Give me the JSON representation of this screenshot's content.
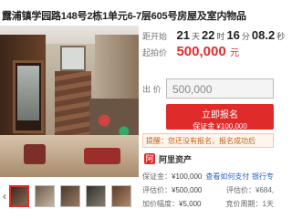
{
  "title": "露浦镇学园路148号2栋1单元6-7层605号房屋及室内物品",
  "countdown": {
    "label": "距开始",
    "days": "21",
    "days_unit": "天",
    "hours": "22",
    "hours_unit": "时",
    "minutes": "16",
    "minutes_unit": "分",
    "seconds": "08.2",
    "seconds_unit": "秒"
  },
  "start_price": {
    "label": "起拍价",
    "value": "500,000",
    "unit": "元"
  },
  "bid": {
    "label": "出 价",
    "value": "500,000"
  },
  "register_button": {
    "line1": "立即报名",
    "line2": "保证金 ¥100,000"
  },
  "notice": "提醒：您还没有报名，报名成功后",
  "brand": {
    "logo_text": "阿",
    "name": "阿里资产"
  },
  "info": {
    "deposit_label": "保证金：",
    "deposit_value": "¥100,000",
    "deposit_link": "查看如何支付",
    "deposit_right": "银行专",
    "valuation_label": "评估价：",
    "valuation_value": "¥500,000",
    "valuation_right": "评估价：¥684,",
    "increment_label": "加价幅度：",
    "increment_value": "¥5,000",
    "increment_right": "竞价周期：1天"
  },
  "thumbnails": [
    "photo-1",
    "photo-2",
    "photo-3",
    "photo-4",
    "photo-5"
  ],
  "colors": {
    "accent": "#e02b2b",
    "link": "#2a62c4",
    "notice_text": "#c0601a"
  }
}
